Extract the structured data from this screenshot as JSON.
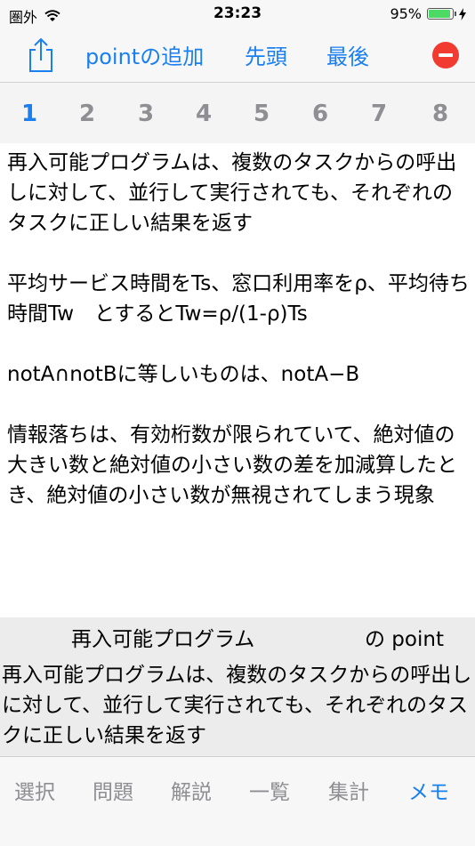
{
  "status": {
    "carrier": "圏外",
    "time": "23:23",
    "battery_percent": "95%",
    "battery_level": 0.95
  },
  "toolbar": {
    "add_point_label": "pointの追加",
    "first_label": "先頭",
    "last_label": "最後"
  },
  "tabs": [
    "1",
    "2",
    "3",
    "4",
    "5",
    "6",
    "7",
    "8"
  ],
  "active_tab": "1",
  "content": {
    "paragraphs": [
      "再入可能プログラムは、複数のタスクからの呼出しに対して、並行して実行されても、それぞれのタスクに正しい結果を返す",
      "平均サービス時間をTs、窓口利用率をρ、平均待ち時間Tw　とするとTw=ρ/(1-ρ)Ts",
      "notA∩notBに等しいものは、notA−B",
      "情報落ちは、有効桁数が限られていて、絶対値の大きい数と絶対値の小さい数の差を加減算したとき、絶対値の小さい数が無視されてしまう現象"
    ]
  },
  "point": {
    "title": "再入可能プログラム",
    "suffix": "の point",
    "text": "再入可能プログラムは、複数のタスクからの呼出しに対して、並行して実行されても、それぞれのタスクに正しい結果を返す"
  },
  "bottom_nav": {
    "items": [
      "選択",
      "問題",
      "解説",
      "一覧",
      "集計",
      "メモ"
    ],
    "active": "メモ"
  },
  "colors": {
    "accent": "#1a7ff0",
    "inactive": "#8e8e93",
    "delete": "#f23b30",
    "battery": "#4cd964"
  }
}
